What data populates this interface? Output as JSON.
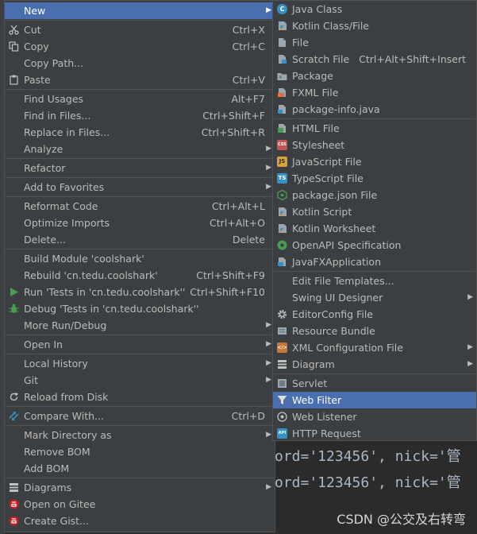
{
  "main_menu": {
    "new": {
      "label": "New"
    },
    "cut": {
      "label": "Cut",
      "shortcut": "Ctrl+X"
    },
    "copy": {
      "label": "Copy",
      "shortcut": "Ctrl+C"
    },
    "copy_path": {
      "label": "Copy Path..."
    },
    "paste": {
      "label": "Paste",
      "shortcut": "Ctrl+V"
    },
    "find_usages": {
      "label": "Find Usages",
      "shortcut": "Alt+F7"
    },
    "find_in_files": {
      "label": "Find in Files...",
      "shortcut": "Ctrl+Shift+F"
    },
    "replace_in_files": {
      "label": "Replace in Files...",
      "shortcut": "Ctrl+Shift+R"
    },
    "analyze": {
      "label": "Analyze"
    },
    "refactor": {
      "label": "Refactor"
    },
    "add_to_favorites": {
      "label": "Add to Favorites"
    },
    "reformat_code": {
      "label": "Reformat Code",
      "shortcut": "Ctrl+Alt+L"
    },
    "optimize_imports": {
      "label": "Optimize Imports",
      "shortcut": "Ctrl+Alt+O"
    },
    "delete": {
      "label": "Delete...",
      "shortcut": "Delete"
    },
    "build_module": {
      "label": "Build Module 'coolshark'"
    },
    "rebuild": {
      "label": "Rebuild 'cn.tedu.coolshark'",
      "shortcut": "Ctrl+Shift+F9"
    },
    "run_tests": {
      "label": "Run 'Tests in 'cn.tedu.coolshark''",
      "shortcut": "Ctrl+Shift+F10"
    },
    "debug_tests": {
      "label": "Debug 'Tests in 'cn.tedu.coolshark''"
    },
    "more_run_debug": {
      "label": "More Run/Debug"
    },
    "open_in": {
      "label": "Open In"
    },
    "local_history": {
      "label": "Local History"
    },
    "git": {
      "label": "Git"
    },
    "reload_from_disk": {
      "label": "Reload from Disk"
    },
    "compare_with": {
      "label": "Compare With...",
      "shortcut": "Ctrl+D"
    },
    "mark_directory_as": {
      "label": "Mark Directory as"
    },
    "remove_bom": {
      "label": "Remove BOM"
    },
    "add_bom": {
      "label": "Add BOM"
    },
    "diagrams": {
      "label": "Diagrams"
    },
    "open_on_gitee": {
      "label": "Open on Gitee"
    },
    "create_gist": {
      "label": "Create Gist..."
    }
  },
  "sub_menu": {
    "java_class": {
      "label": "Java Class"
    },
    "kotlin_class_file": {
      "label": "Kotlin Class/File"
    },
    "file": {
      "label": "File"
    },
    "scratch_file": {
      "label": "Scratch File",
      "shortcut": "Ctrl+Alt+Shift+Insert"
    },
    "package": {
      "label": "Package"
    },
    "fxml_file": {
      "label": "FXML File"
    },
    "package_info_java": {
      "label": "package-info.java"
    },
    "html_file": {
      "label": "HTML File"
    },
    "stylesheet": {
      "label": "Stylesheet"
    },
    "javascript_file": {
      "label": "JavaScript File"
    },
    "typescript_file": {
      "label": "TypeScript File"
    },
    "package_json_file": {
      "label": "package.json File"
    },
    "kotlin_script": {
      "label": "Kotlin Script"
    },
    "kotlin_worksheet": {
      "label": "Kotlin Worksheet"
    },
    "openapi_specification": {
      "label": "OpenAPI Specification"
    },
    "javafx_application": {
      "label": "JavaFXApplication"
    },
    "edit_file_templates": {
      "label": "Edit File Templates..."
    },
    "swing_ui_designer": {
      "label": "Swing UI Designer"
    },
    "editorconfig_file": {
      "label": "EditorConfig File"
    },
    "resource_bundle": {
      "label": "Resource Bundle"
    },
    "xml_configuration_file": {
      "label": "XML Configuration File"
    },
    "diagram": {
      "label": "Diagram"
    },
    "servlet": {
      "label": "Servlet"
    },
    "web_filter": {
      "label": "Web Filter"
    },
    "web_listener": {
      "label": "Web Listener"
    },
    "http_request": {
      "label": "HTTP Request"
    }
  },
  "icons": {
    "js_badge": "JS",
    "ts_badge": "TS",
    "css_badge": "CSS",
    "api_badge": "API",
    "xml_badge": "</>"
  },
  "editor": {
    "line1": "ord='123456', nick='管",
    "line2": "ord='123456', nick='管"
  },
  "watermark": "CSDN @公交及右转弯",
  "colors": {
    "menu_bg": "#3c3f41",
    "highlight": "#4b6eaf",
    "text": "#bbbbbb"
  }
}
